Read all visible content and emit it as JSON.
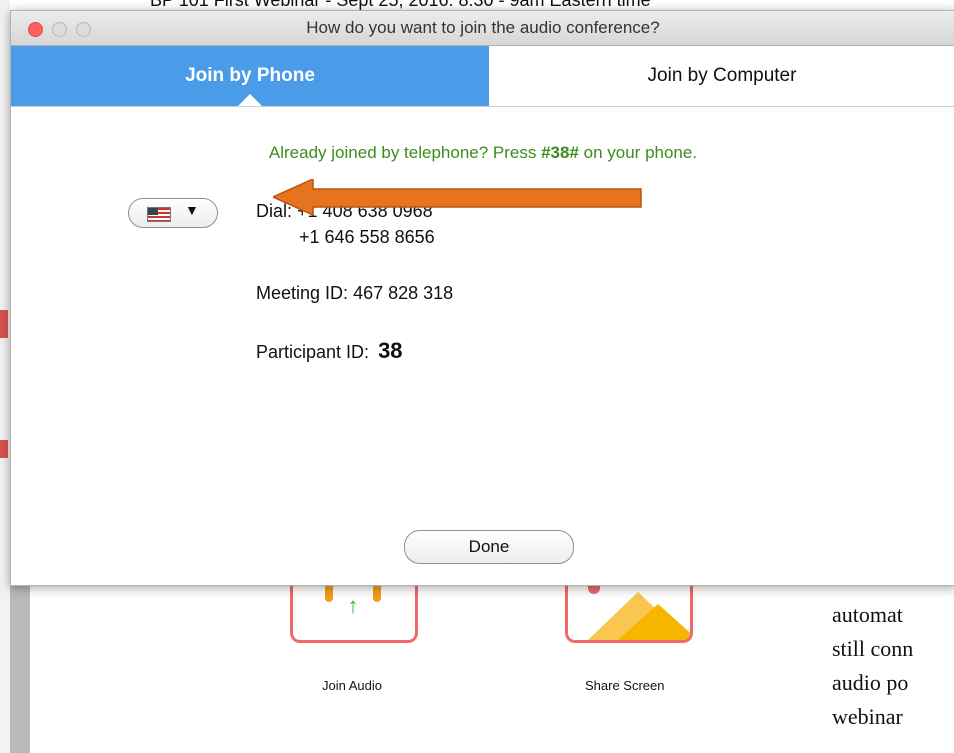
{
  "background": {
    "top_text": "BP 101 First Webinar - Sept 25, 2016: 8:30 - 9am Eastern time",
    "icons": [
      {
        "label": "Join Audio",
        "icon": "join-audio-icon"
      },
      {
        "label": "Share Screen",
        "icon": "share-screen-icon"
      }
    ],
    "side_text": [
      "automat",
      "still conn",
      "audio po",
      "webinar"
    ]
  },
  "dialog": {
    "title": "How do you want to join the audio conference?",
    "tabs": [
      "Join by Phone",
      "Join by Computer"
    ],
    "selected_tab": "Join by Phone",
    "hint": {
      "prefix": "Already joined by telephone? Press ",
      "code": "#38#",
      "suffix": " on your phone."
    },
    "country_selector": {
      "flag": "us-flag-icon",
      "chevron": "chevron-down-icon"
    },
    "dial_label": "Dial:",
    "dial_numbers": [
      "+1 408 638 0968",
      "+1 646 558 8656"
    ],
    "meeting_id_label": "Meeting ID:",
    "meeting_id": "467 828 318",
    "participant_id_label": "Participant ID:",
    "participant_id": "38",
    "done_label": "Done"
  },
  "colors": {
    "tab_active": "#4a9be8",
    "hint_green": "#3d8c1e",
    "annotation_arrow": "#e8731f"
  }
}
